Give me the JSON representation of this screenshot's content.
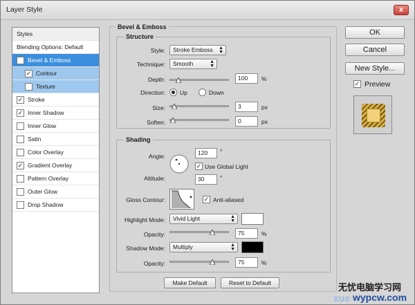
{
  "window": {
    "title": "Layer Style",
    "close_glyph": "x"
  },
  "styles_list": {
    "header": "Styles",
    "items": [
      {
        "label": "Blending Options: Default",
        "checkbox": false,
        "checked": false,
        "state": "normal",
        "indent": 0
      },
      {
        "label": "Bevel & Emboss",
        "checkbox": true,
        "checked": true,
        "state": "selected",
        "indent": 0
      },
      {
        "label": "Contour",
        "checkbox": true,
        "checked": true,
        "state": "sub",
        "indent": 1
      },
      {
        "label": "Texture",
        "checkbox": true,
        "checked": false,
        "state": "sub",
        "indent": 1
      },
      {
        "label": "Stroke",
        "checkbox": true,
        "checked": true,
        "state": "normal",
        "indent": 0
      },
      {
        "label": "Inner Shadow",
        "checkbox": true,
        "checked": true,
        "state": "normal",
        "indent": 0
      },
      {
        "label": "Inner Glow",
        "checkbox": true,
        "checked": false,
        "state": "normal",
        "indent": 0
      },
      {
        "label": "Satin",
        "checkbox": true,
        "checked": false,
        "state": "normal",
        "indent": 0
      },
      {
        "label": "Color Overlay",
        "checkbox": true,
        "checked": false,
        "state": "normal",
        "indent": 0
      },
      {
        "label": "Gradient Overlay",
        "checkbox": true,
        "checked": true,
        "state": "normal",
        "indent": 0
      },
      {
        "label": "Pattern Overlay",
        "checkbox": true,
        "checked": false,
        "state": "normal",
        "indent": 0
      },
      {
        "label": "Outer Glow",
        "checkbox": true,
        "checked": false,
        "state": "normal",
        "indent": 0
      },
      {
        "label": "Drop Shadow",
        "checkbox": true,
        "checked": false,
        "state": "normal",
        "indent": 0
      }
    ]
  },
  "bevel": {
    "section_title": "Bevel & Emboss",
    "structure": {
      "title": "Structure",
      "style_label": "Style:",
      "style_value": "Stroke Emboss",
      "technique_label": "Technique:",
      "technique_value": "Smooth",
      "depth_label": "Depth:",
      "depth_value": "100",
      "depth_unit": "%",
      "depth_level": 0.1,
      "direction_label": "Direction:",
      "direction_up": "Up",
      "direction_down": "Down",
      "direction_selected": "Up",
      "size_label": "Size:",
      "size_value": "3",
      "size_unit": "px",
      "size_level": 0.02,
      "soften_label": "Soften:",
      "soften_value": "0",
      "soften_unit": "px",
      "soften_level": 0.0
    },
    "shading": {
      "title": "Shading",
      "angle_label": "Angle:",
      "angle_value": "120",
      "angle_unit": "°",
      "global_light_label": "Use Global Light",
      "global_light_checked": true,
      "altitude_label": "Altitude:",
      "altitude_value": "30",
      "altitude_unit": "°",
      "gloss_label": "Gloss Contour:",
      "anti_alias_label": "Anti-aliased",
      "anti_alias_checked": true,
      "highlight_mode_label": "Highlight Mode:",
      "highlight_mode_value": "Vivid Light",
      "highlight_color": "#ffffff",
      "highlight_opacity_label": "Opacity:",
      "highlight_opacity_value": "75",
      "highlight_opacity_unit": "%",
      "highlight_opacity_level": 0.75,
      "shadow_mode_label": "Shadow Mode:",
      "shadow_mode_value": "Multiply",
      "shadow_color": "#000000",
      "shadow_opacity_label": "Opacity:",
      "shadow_opacity_value": "75",
      "shadow_opacity_unit": "%",
      "shadow_opacity_level": 0.75
    },
    "make_default_label": "Make Default",
    "reset_default_label": "Reset to Default"
  },
  "right": {
    "ok_label": "OK",
    "cancel_label": "Cancel",
    "new_style_label": "New Style...",
    "preview_label": "Preview",
    "preview_checked": true
  },
  "watermark": {
    "cn": "无忧电脑学习网",
    "url": "wypcw.com",
    "faint": "xue"
  },
  "colors": {
    "selection": "#3b8fdc",
    "selection_sub": "#9ec8ee",
    "preview_gold": "#e8c866"
  }
}
